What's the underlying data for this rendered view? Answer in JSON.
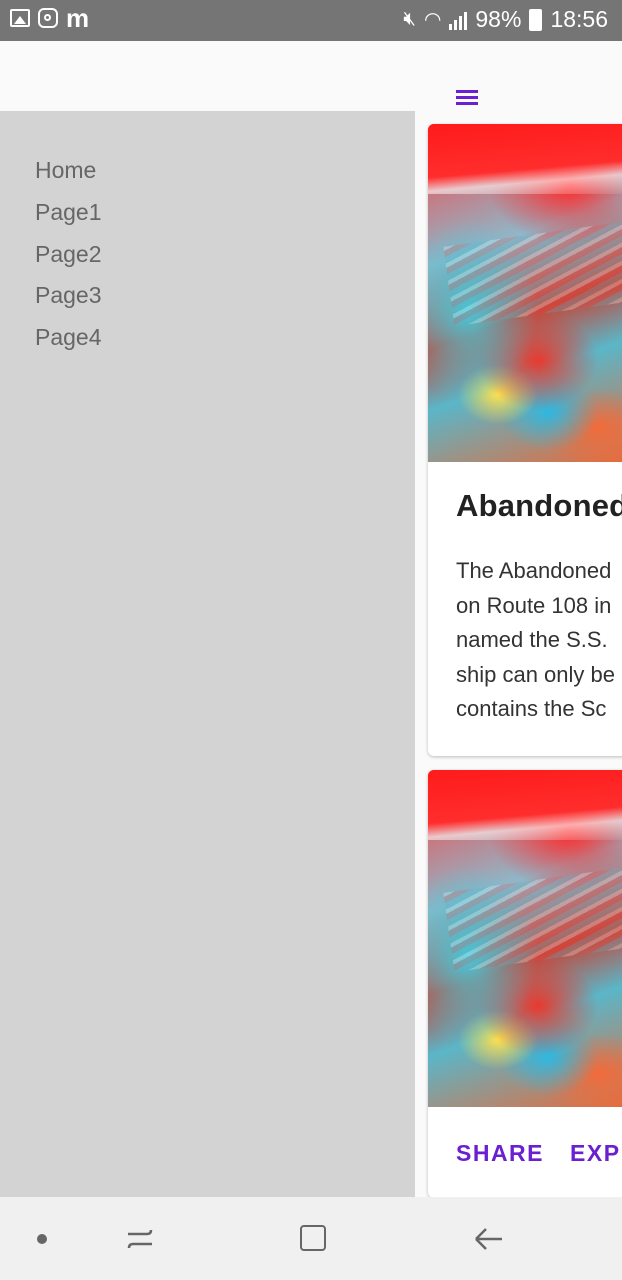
{
  "status_bar": {
    "battery": "98%",
    "time": "18:56",
    "icons": [
      "gallery-icon",
      "instagram-icon",
      "m-app-icon",
      "mute-icon",
      "wifi-icon",
      "signal-icon",
      "battery-charging-icon"
    ]
  },
  "header": {
    "menu_icon": "menu-icon"
  },
  "drawer": {
    "items": [
      {
        "label": "Home"
      },
      {
        "label": "Page1"
      },
      {
        "label": "Page2"
      },
      {
        "label": "Page3"
      },
      {
        "label": "Page4"
      }
    ]
  },
  "cards": [
    {
      "title": "Abandoned",
      "body_lines": [
        "The Abandoned",
        "on Route 108 in",
        "named the S.S.",
        "ship can only be",
        "contains the Sc"
      ]
    },
    {
      "actions": [
        {
          "label": "SHARE"
        },
        {
          "label": "EXP"
        }
      ]
    }
  ],
  "colors": {
    "accent": "#6a1fd0",
    "drawer_bg": "#d3d3d3",
    "status_bar_bg": "#757575"
  },
  "nav_bar": {
    "icons": [
      "nav-dot-icon",
      "recent-apps-icon",
      "home-icon",
      "back-icon"
    ]
  }
}
